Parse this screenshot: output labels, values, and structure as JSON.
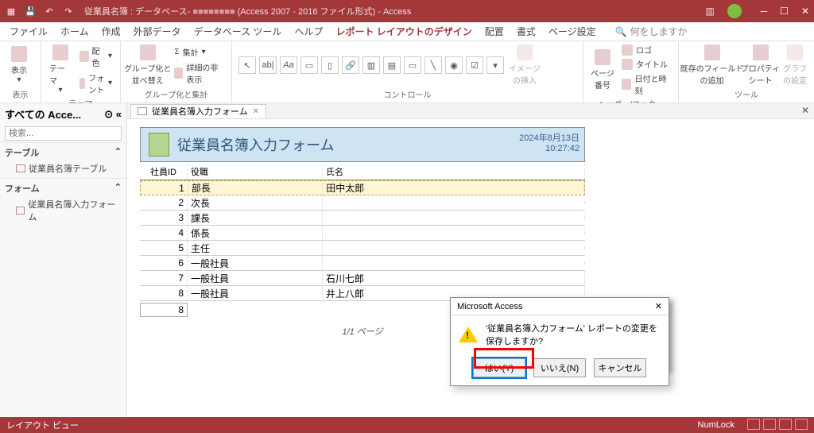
{
  "titlebar": {
    "db_label": "従業員名簿 : データベース-",
    "format_label": "(Access 2007 - 2016 ファイル形式)",
    "app_name": "Access"
  },
  "menutabs": {
    "file": "ファイル",
    "home": "ホーム",
    "create": "作成",
    "external": "外部データ",
    "dbtools": "データベース ツール",
    "help": "ヘルプ",
    "design": "レポート レイアウトのデザイン",
    "arrange": "配置",
    "format": "書式",
    "pagesetup": "ページ設定",
    "search_placeholder": "何をしますか"
  },
  "ribbon": {
    "group_view": "表示",
    "view_btn": "表示",
    "group_theme": "テーマ",
    "theme_btn": "テーマ",
    "colors_btn": "配色",
    "fonts_btn": "フォント",
    "group_grouping": "グループ化と集計",
    "group_sort_btn": "グループ化と\n並べ替え",
    "totals_btn": "集計",
    "hide_detail_btn": "詳細の非表示",
    "group_controls": "コントロール",
    "insert_image_btn": "イメージ\nの挿入",
    "group_hdrftr": "ヘッダー/フッター",
    "page_no_btn": "ページ\n番号",
    "logo_btn": "ロゴ",
    "title_btn": "タイトル",
    "datetime_btn": "日付と時刻",
    "group_tools": "ツール",
    "existing_fields_btn": "既存のフィールド\nの追加",
    "property_sheet_btn": "プロパティ\nシート",
    "chart_settings_btn": "グラフ\nの設定"
  },
  "nav": {
    "header": "すべての Acce...",
    "search_placeholder": "検索...",
    "sec_tables": "テーブル",
    "sec_forms": "フォーム",
    "item_table": "従業員名簿テーブル",
    "item_form": "従業員名簿入力フォーム"
  },
  "doc": {
    "tab_label": "従業員名簿入力フォーム",
    "report_title": "従業員名簿入力フォーム",
    "date": "2024年8月13日",
    "time": "10:27:42",
    "col_id": "社員ID",
    "col_role": "役職",
    "col_name": "氏名",
    "rows": [
      {
        "id": "1",
        "role": "部長",
        "name": "田中太郎"
      },
      {
        "id": "2",
        "role": "次長",
        "name": ""
      },
      {
        "id": "3",
        "role": "課長",
        "name": ""
      },
      {
        "id": "4",
        "role": "係長",
        "name": ""
      },
      {
        "id": "5",
        "role": "主任",
        "name": ""
      },
      {
        "id": "6",
        "role": "一般社員",
        "name": ""
      },
      {
        "id": "7",
        "role": "一般社員",
        "name": "石川七郎"
      },
      {
        "id": "8",
        "role": "一般社員",
        "name": "井上八郎"
      }
    ],
    "total_count": "8",
    "pager": "1/1 ページ"
  },
  "dialog": {
    "title": "Microsoft Access",
    "message": "'従業員名簿入力フォーム' レポートの変更を保存しますか?",
    "yes": "はい(Y)",
    "no": "いいえ(N)",
    "cancel": "キャンセル"
  },
  "statusbar": {
    "view_label": "レイアウト ビュー",
    "numlock": "NumLock"
  }
}
